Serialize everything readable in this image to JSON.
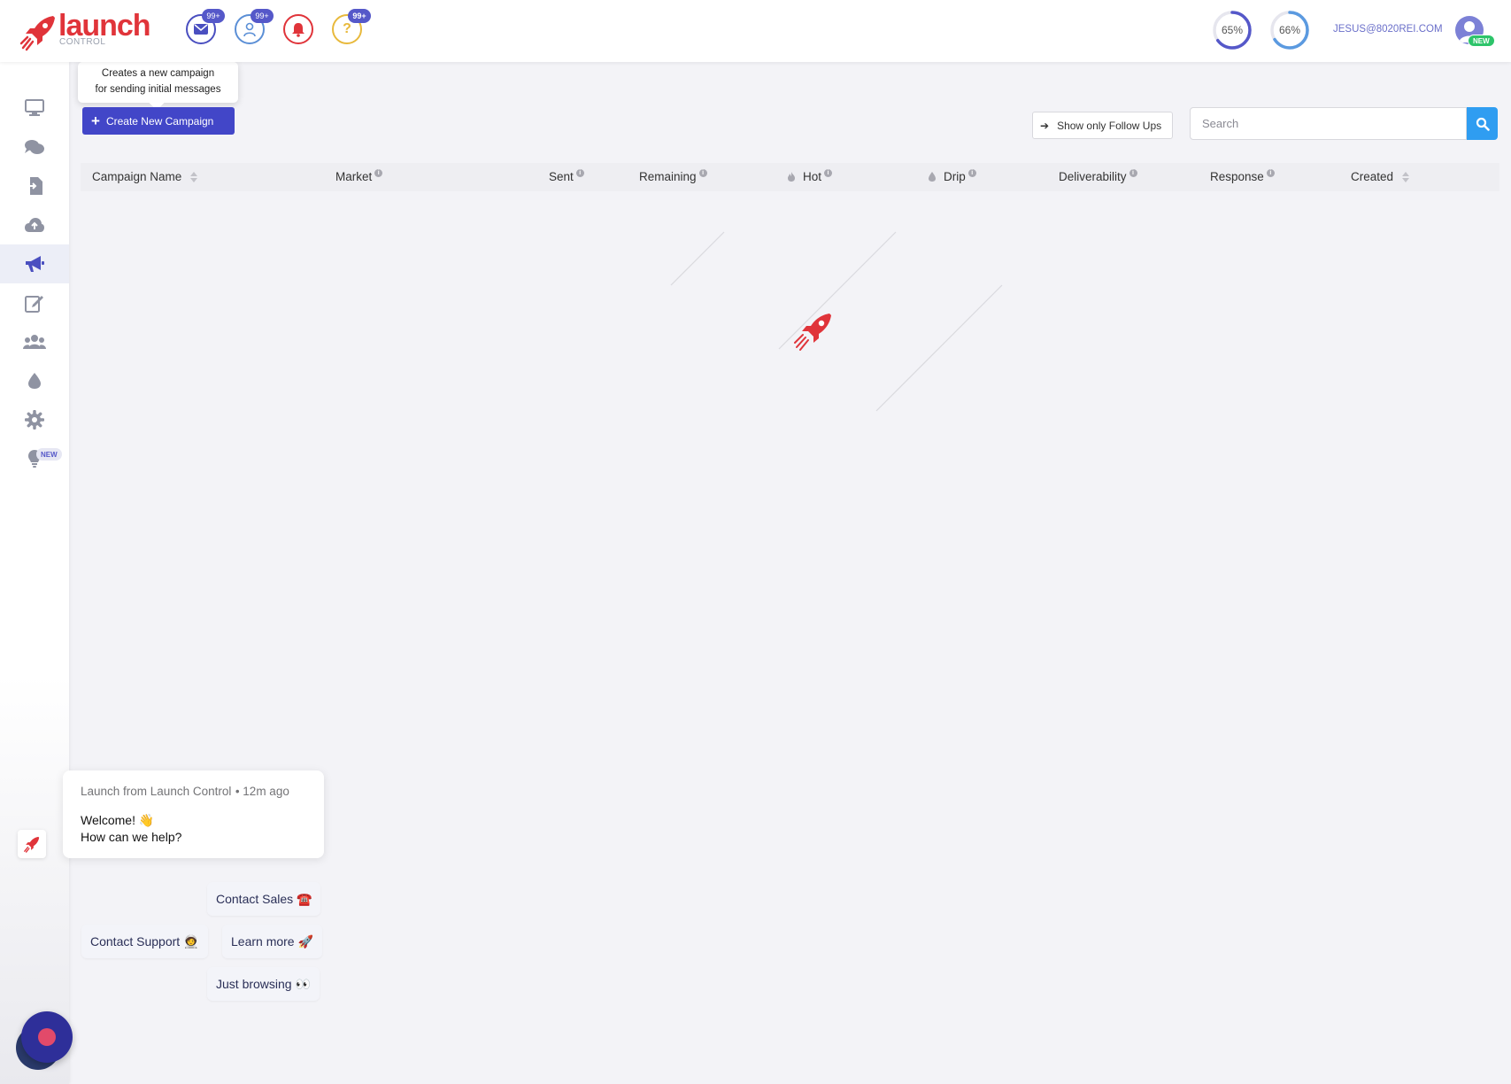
{
  "brand": {
    "name": "launch",
    "sub": "CONTROL",
    "accent": "#e0343a"
  },
  "header": {
    "icons": [
      {
        "name": "mail-icon",
        "badge": "99+",
        "color": "#4a4fc0"
      },
      {
        "name": "user-alert-icon",
        "badge": "99+",
        "color": "#5b8fd6"
      },
      {
        "name": "bell-icon",
        "badge": "",
        "color": "#e0343a"
      },
      {
        "name": "help-icon",
        "badge": "99+",
        "color": "#e8b93c"
      }
    ],
    "progress": [
      {
        "label": "65%",
        "value": 0.65,
        "color": "#5558c9"
      },
      {
        "label": "66%",
        "value": 0.66,
        "color": "#5b9ae0"
      }
    ],
    "user_email": "JESUS@8020REI.COM",
    "avatar_badge": "NEW"
  },
  "sidebar": {
    "items": [
      {
        "icon": "monitor-icon"
      },
      {
        "icon": "chat-icon"
      },
      {
        "icon": "import-icon"
      },
      {
        "icon": "cloud-upload-icon"
      },
      {
        "icon": "megaphone-icon",
        "active": true
      },
      {
        "icon": "edit-icon"
      },
      {
        "icon": "users-icon"
      },
      {
        "icon": "drip-icon"
      },
      {
        "icon": "settings-icon"
      },
      {
        "icon": "lightbulb-icon",
        "badge": "NEW"
      }
    ]
  },
  "toolbar": {
    "tooltip_line1": "Creates a new campaign",
    "tooltip_line2": "for sending initial messages",
    "create_label": "Create New Campaign",
    "follow_label": "Show only Follow Ups",
    "search_placeholder": "Search"
  },
  "table": {
    "columns": [
      {
        "label": "Campaign Name",
        "sortable": true
      },
      {
        "label": "Market",
        "info": true
      },
      {
        "label": "Sent",
        "info": true
      },
      {
        "label": "Remaining",
        "info": true
      },
      {
        "label": "Hot",
        "info": true,
        "icon": "fire-icon"
      },
      {
        "label": "Drip",
        "info": true,
        "icon": "drop-icon"
      },
      {
        "label": "Deliverability",
        "info": true
      },
      {
        "label": "Response",
        "info": true
      },
      {
        "label": "Created",
        "sortable": true
      }
    ]
  },
  "chat": {
    "sender": "Launch from Launch Control",
    "time": "12m ago",
    "line1": "Welcome! 👋",
    "line2": "How can we help?",
    "replies": {
      "sales": "Contact Sales ☎️",
      "support": "Contact Support 🧑‍🚀",
      "learn": "Learn more 🚀",
      "browsing": "Just browsing 👀"
    }
  }
}
